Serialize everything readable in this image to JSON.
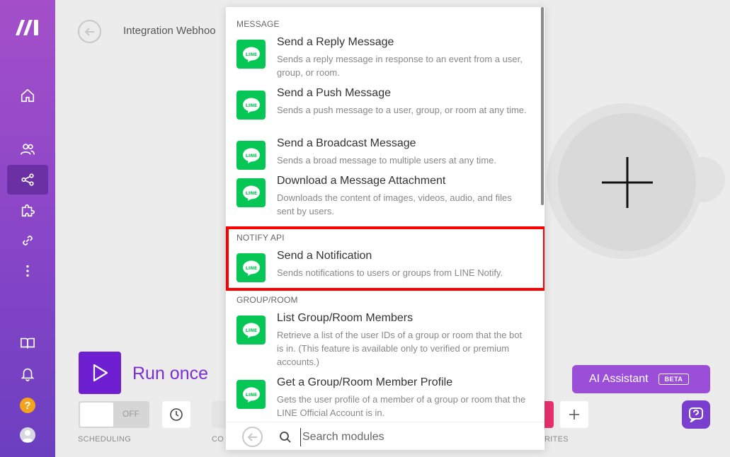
{
  "header": {
    "scenario_title": "Integration Webhoo"
  },
  "sidebar": {
    "items": [
      {
        "icon": "home-icon"
      },
      {
        "icon": "team-icon"
      },
      {
        "icon": "share-icon",
        "active": true
      },
      {
        "icon": "puzzle-icon"
      },
      {
        "icon": "link-icon"
      },
      {
        "icon": "more-icon"
      },
      {
        "icon": "book-icon"
      },
      {
        "icon": "bell-icon"
      }
    ],
    "help_label": "?"
  },
  "toolbar": {
    "run_label": "Run once",
    "toggle_state": "OFF",
    "scheduling_label": "SCHEDULING",
    "controls_label_partial": "CO",
    "favorites_label_partial": "RITES"
  },
  "ai_assistant": {
    "label": "AI Assistant",
    "badge": "BETA"
  },
  "module_picker": {
    "sections": [
      {
        "heading": "MESSAGE",
        "items": [
          {
            "title": "Send a Reply Message",
            "desc": "Sends a reply message in response to an event from a user, group, or room."
          },
          {
            "title": "Send a Push Message",
            "desc": "Sends a push message to a user, group, or room at any time."
          },
          {
            "title": "Send a Broadcast Message",
            "desc": "Sends a broad message to multiple users at any time."
          },
          {
            "title": "Download a Message Attachment",
            "desc": "Downloads the content of images, videos, audio, and files sent by users."
          }
        ]
      },
      {
        "heading": "NOTIFY API",
        "items": [
          {
            "title": "Send a Notification",
            "desc": "Sends notifications to users or groups from LINE Notify."
          }
        ]
      },
      {
        "heading": "GROUP/ROOM",
        "items": [
          {
            "title": "List Group/Room Members",
            "desc": "Retrieve a list of the user IDs of a group or room that the bot is in. (This feature is available only to verified or premium accounts.)"
          },
          {
            "title": "Get a Group/Room Member Profile",
            "desc": "Gets the user profile of a member of a group or room that the LINE Official Account is in."
          }
        ]
      }
    ],
    "icon_text": "LINE",
    "search_placeholder": "Search modules"
  },
  "colors": {
    "line_green": "#06c755",
    "run_purple": "#6d1fd1",
    "highlight_red": "#ff0000",
    "ai_purple": "#9b4fd8"
  }
}
